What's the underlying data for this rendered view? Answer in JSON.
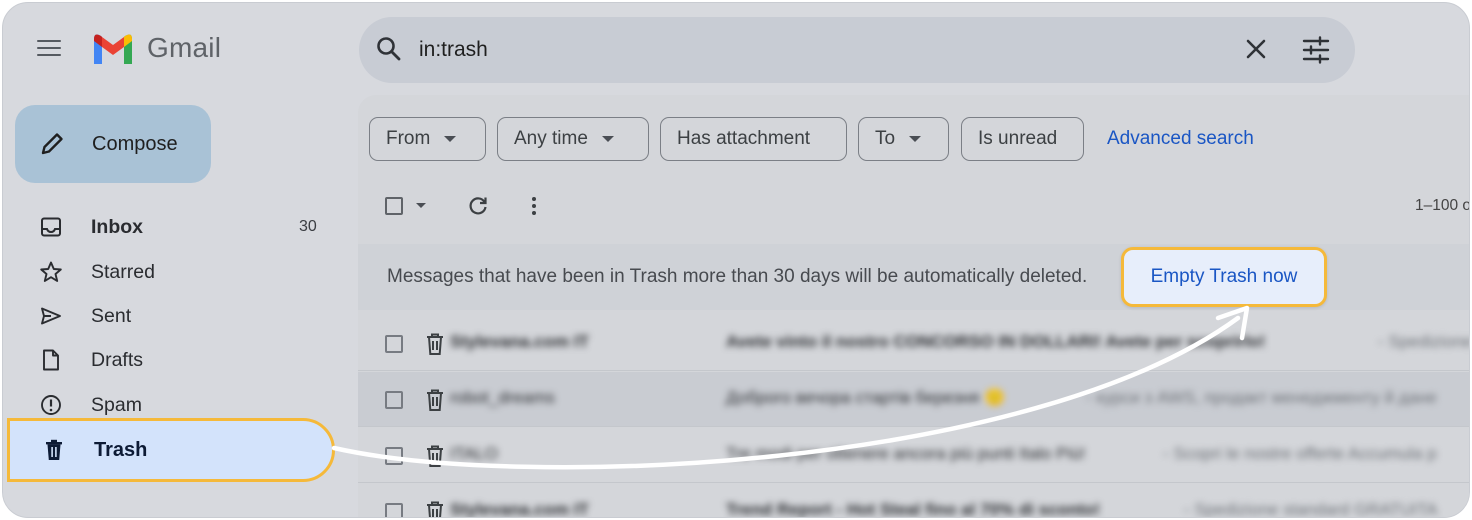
{
  "app": {
    "name": "Gmail"
  },
  "search": {
    "query": "in:trash"
  },
  "sidebar": {
    "compose_label": "Compose",
    "items": [
      {
        "label": "Inbox",
        "count": "30",
        "icon": "inbox-icon"
      },
      {
        "label": "Starred",
        "icon": "star-icon"
      },
      {
        "label": "Sent",
        "icon": "send-icon"
      },
      {
        "label": "Drafts",
        "icon": "draft-icon"
      },
      {
        "label": "Spam",
        "icon": "spam-icon"
      },
      {
        "label": "Trash",
        "icon": "trash-icon",
        "selected": true
      }
    ]
  },
  "filters": {
    "from": "From",
    "any_time": "Any time",
    "has_attachment": "Has attachment",
    "to": "To",
    "is_unread": "Is unread",
    "advanced_search": "Advanced search"
  },
  "toolbar": {
    "pager": "1–100 o"
  },
  "notice": {
    "text": "Messages that have been in Trash more than 30 days will be automatically deleted.",
    "button": "Empty Trash now"
  },
  "emails": [
    {
      "sender": "Stylevana.com IT",
      "subject": "Avete vinto il nostro CONCORSO IN DOLLARI! Avete per scoprirlo!",
      "snippet": "- Spedizione"
    },
    {
      "sender": "robot_dreams",
      "subject": "Доброго вечора стартів березня 🙂",
      "snippet": "- курси з AWS, продакт менеджменту й дане"
    },
    {
      "sender": "ITALO",
      "subject": "Tre modi per ottenere ancora più punti Italo Più!",
      "snippet": "- Scopri le nostre offerte Accumula p"
    },
    {
      "sender": "Stylevana.com IT",
      "subject": "Trend Report - Hot Steal fino al 70% di sconto!",
      "snippet": "- Spedizione standard GRATUITA"
    }
  ],
  "colors": {
    "highlight_border": "#f5b93a",
    "link_blue": "#1a56c4",
    "selected_bg": "#d3e3fb",
    "compose_bg": "#a9c2d6"
  }
}
